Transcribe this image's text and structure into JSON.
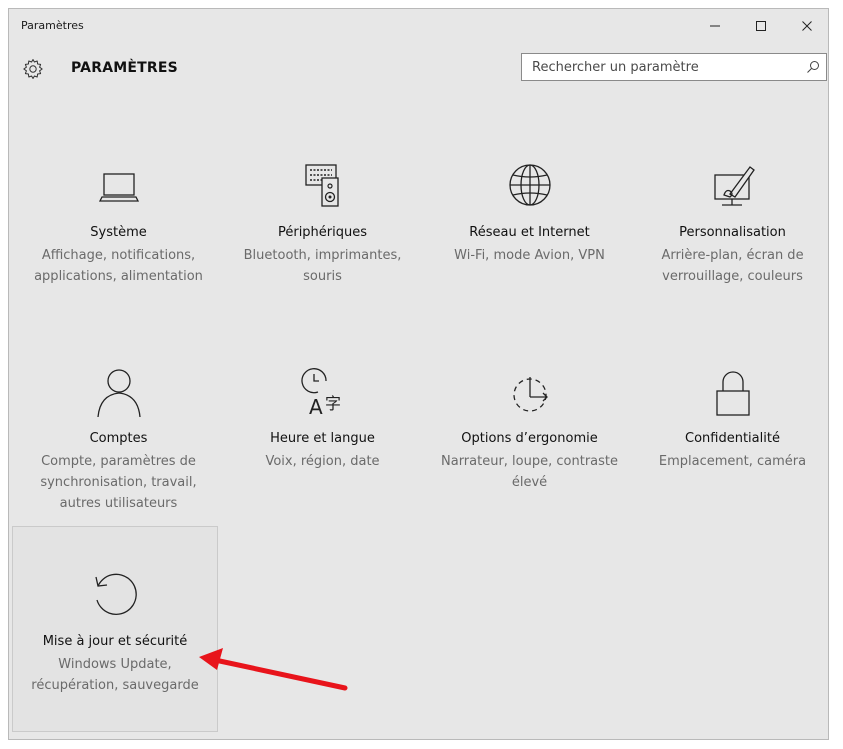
{
  "window": {
    "title": "Paramètres",
    "controls": [
      "–",
      "☐",
      "✕"
    ]
  },
  "header": {
    "title": "PARAMÈTRES",
    "search_placeholder": "Rechercher un paramètre"
  },
  "tiles": [
    {
      "icon": "laptop-icon",
      "title": "Système",
      "desc": "Affichage, notifications, applications, alimentation"
    },
    {
      "icon": "keyboard-speaker-icon",
      "title": "Périphériques",
      "desc": "Bluetooth, imprimantes, souris"
    },
    {
      "icon": "globe-icon",
      "title": "Réseau et Internet",
      "desc": "Wi-Fi, mode Avion, VPN"
    },
    {
      "icon": "paint-screen-icon",
      "title": "Personnalisation",
      "desc": "Arrière-plan, écran de verrouillage, couleurs"
    },
    {
      "icon": "person-icon",
      "title": "Comptes",
      "desc": "Compte, paramètres de synchronisation, travail, autres utilisateurs"
    },
    {
      "icon": "time-language-icon",
      "title": "Heure et langue",
      "desc": "Voix, région, date"
    },
    {
      "icon": "ease-of-access-icon",
      "title": "Options d’ergonomie",
      "desc": "Narrateur, loupe, contraste élevé"
    },
    {
      "icon": "lock-icon",
      "title": "Confidentialité",
      "desc": "Emplacement, caméra"
    },
    {
      "icon": "update-icon",
      "title": "Mise à jour et sécurité",
      "desc": "Windows Update, récupération, sauvegarde"
    }
  ],
  "colors": {
    "background": "#e7e7e7",
    "arrow": "#e8141b"
  }
}
